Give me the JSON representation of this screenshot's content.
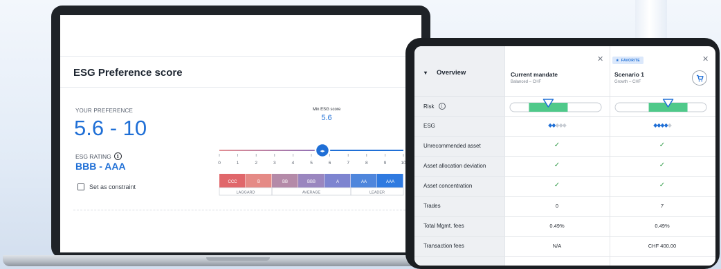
{
  "laptop": {
    "card_title": "ESG Preference score",
    "preference_label": "YOUR PREFERENCE",
    "preference_value": "5.6 - 10",
    "rating_label": "ESG RATING",
    "rating_info_glyph": "i",
    "rating_value": "BBB - AAA",
    "constraint_label": "Set as constraint",
    "slider": {
      "caption": "Min ESG score",
      "value": 5.6,
      "value_label": "5.6",
      "min": 0,
      "max": 10,
      "ticks": [
        "0",
        "1",
        "2",
        "3",
        "4",
        "5",
        "6",
        "7",
        "8",
        "9",
        "10"
      ],
      "ratings": [
        "CCC",
        "B",
        "BB",
        "BBB",
        "A",
        "AA",
        "AAA"
      ],
      "rating_colors": [
        "#e0676b",
        "#e58a86",
        "#b48aa8",
        "#9a86bf",
        "#7d84d0",
        "#4f86dc",
        "#2f7ae0"
      ],
      "groups": [
        "LAGGARD",
        "AVERAGE",
        "LEADER"
      ],
      "group_spans": [
        2,
        3,
        2
      ],
      "track_colors": [
        "#e28e93",
        "#1f6fd6"
      ]
    }
  },
  "tablet": {
    "overview_label": "Overview",
    "columns": [
      {
        "title": "Current mandate",
        "subtitle": "Balanced – CHF",
        "favorite": false,
        "risk": 0.42
      },
      {
        "title": "Scenario 1",
        "subtitle": "Growth – CHF",
        "favorite": true,
        "favorite_label": "FAVORITE",
        "risk": 0.58
      }
    ],
    "rows": [
      {
        "label": "Risk",
        "info": true,
        "type": "risk"
      },
      {
        "label": "ESG",
        "type": "leaves",
        "values": [
          2,
          4
        ],
        "max": 5
      },
      {
        "label": "Unrecommended asset",
        "type": "check"
      },
      {
        "label": "Asset allocation deviation",
        "type": "check"
      },
      {
        "label": "Asset concentration",
        "type": "check"
      },
      {
        "label": "Trades",
        "type": "text",
        "values": [
          "0",
          "7"
        ]
      },
      {
        "label": "Total Mgmt. fees",
        "type": "text",
        "values": [
          "0.49%",
          "0.49%"
        ]
      },
      {
        "label": "Transaction fees",
        "type": "text",
        "values": [
          "N/A",
          "CHF 400.00"
        ]
      }
    ],
    "risk_colors": {
      "band": "#4fc98a",
      "track": "#e8ebef",
      "marker": "#1f6fd6"
    }
  }
}
